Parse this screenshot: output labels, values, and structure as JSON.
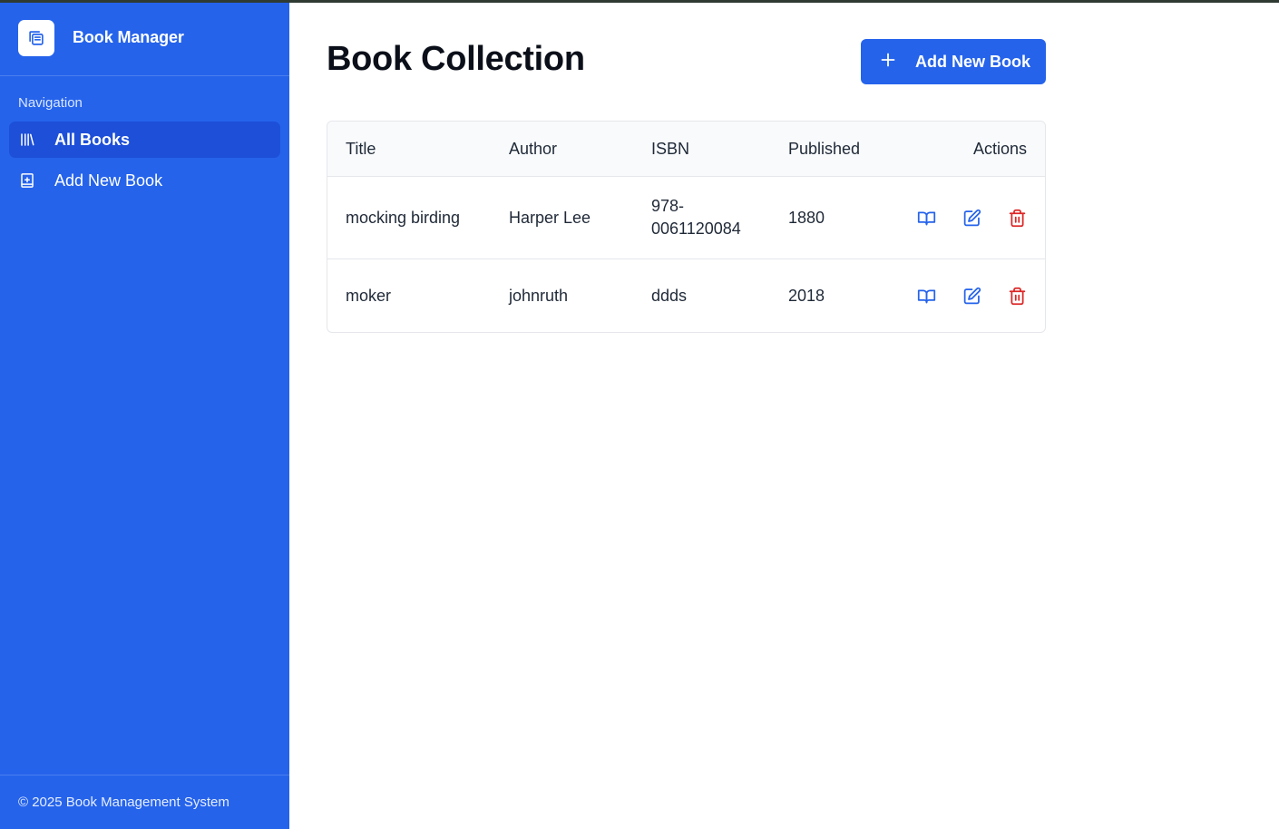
{
  "sidebar": {
    "brand_title": "Book Manager",
    "brand_icon": "books-copy-icon",
    "nav_label": "Navigation",
    "items": [
      {
        "label": "All Books",
        "icon": "library-icon",
        "active": true
      },
      {
        "label": "Add New Book",
        "icon": "book-plus-icon",
        "active": false
      }
    ],
    "footer": "© 2025 Book Management System"
  },
  "main": {
    "title": "Book Collection",
    "add_button_label": "Add New Book",
    "table": {
      "columns": [
        "Title",
        "Author",
        "ISBN",
        "Published",
        "Actions"
      ],
      "rows": [
        {
          "title": "mocking birding",
          "author": "Harper Lee",
          "isbn_line1": "978-",
          "isbn_line2": "0061120084",
          "published": "1880"
        },
        {
          "title": "moker",
          "author": "johnruth",
          "isbn_line1": "ddds",
          "isbn_line2": "",
          "published": "2018"
        }
      ],
      "actions": [
        "view-book-icon",
        "edit-icon",
        "delete-trash-icon"
      ]
    }
  },
  "colors": {
    "primary": "#2563eb",
    "primary_active": "#1d4fd8",
    "danger": "#dc2626"
  }
}
